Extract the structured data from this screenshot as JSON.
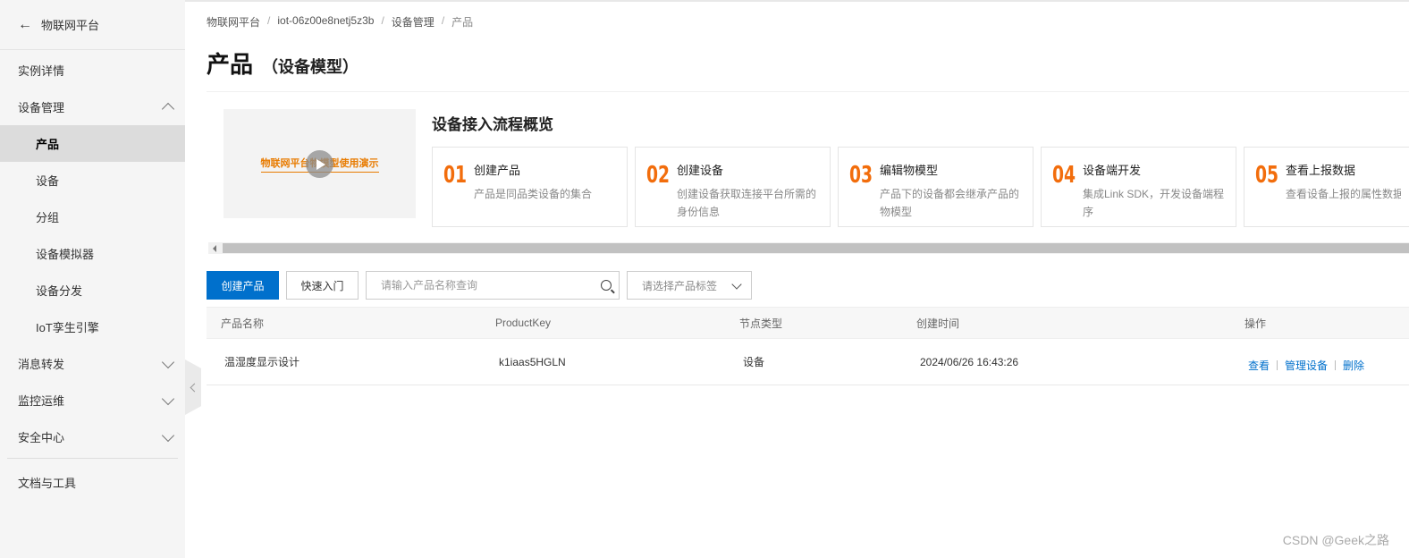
{
  "sidebar": {
    "back_label": "物联网平台",
    "items": [
      {
        "label": "实例详情"
      },
      {
        "label": "设备管理"
      },
      {
        "label": "产品"
      },
      {
        "label": "设备"
      },
      {
        "label": "分组"
      },
      {
        "label": "设备模拟器"
      },
      {
        "label": "设备分发"
      },
      {
        "label": "IoT孪生引擎"
      },
      {
        "label": "消息转发"
      },
      {
        "label": "监控运维"
      },
      {
        "label": "安全中心"
      },
      {
        "label": "文档与工具"
      }
    ]
  },
  "breadcrumb": [
    "物联网平台",
    "iot-06z00e8netj5z3b",
    "设备管理",
    "产品"
  ],
  "page": {
    "title": "产品",
    "subtitle": "（设备模型）"
  },
  "overview": {
    "video_title": "物联网平台物模型使用演示",
    "title": "设备接入流程概览",
    "steps": [
      {
        "num": "01",
        "name": "创建产品",
        "desc": "产品是同品类设备的集合"
      },
      {
        "num": "02",
        "name": "创建设备",
        "desc": "创建设备获取连接平台所需的身份信息"
      },
      {
        "num": "03",
        "name": "编辑物模型",
        "desc": "产品下的设备都会继承产品的物模型"
      },
      {
        "num": "04",
        "name": "设备端开发",
        "desc": "集成Link SDK，开发设备端程序"
      },
      {
        "num": "05",
        "name": "查看上报数据",
        "desc": "查看设备上报的属性数据"
      }
    ]
  },
  "toolbar": {
    "create_label": "创建产品",
    "quickstart_label": "快速入门",
    "search_placeholder": "请输入产品名称查询",
    "tag_select_label": "请选择产品标签"
  },
  "table": {
    "columns": [
      "产品名称",
      "ProductKey",
      "节点类型",
      "创建时间",
      "操作"
    ],
    "rows": [
      {
        "name": "温湿度显示设计",
        "key": "k1iaas5HGLN",
        "node_type": "设备",
        "created": "2024/06/26 16:43:26",
        "ops": [
          "查看",
          "管理设备",
          "删除"
        ]
      }
    ]
  },
  "watermark": "CSDN @Geek之路",
  "colors": {
    "primary": "#0070cc",
    "step_number": "#f26d0c",
    "video_title": "#e87b00"
  }
}
